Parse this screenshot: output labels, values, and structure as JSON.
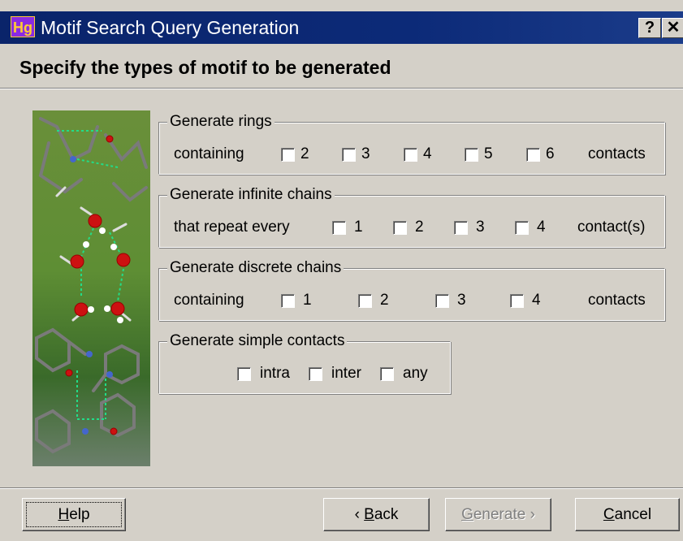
{
  "window": {
    "app_icon_text": "Hg",
    "title": "Motif Search Query Generation",
    "help_glyph": "?",
    "close_glyph": "✕"
  },
  "heading": "Specify the types of motif to be generated",
  "rings": {
    "legend": "Generate rings",
    "prefix": "containing",
    "options": [
      "2",
      "3",
      "4",
      "5",
      "6"
    ],
    "suffix": "contacts"
  },
  "infinite": {
    "legend": "Generate infinite chains",
    "prefix": "that repeat every",
    "options": [
      "1",
      "2",
      "3",
      "4"
    ],
    "suffix": "contact(s)"
  },
  "discrete": {
    "legend": "Generate discrete chains",
    "prefix": "containing",
    "options": [
      "1",
      "2",
      "3",
      "4"
    ],
    "suffix": "contacts"
  },
  "simple": {
    "legend": "Generate simple contacts",
    "options": [
      "intra",
      "inter",
      "any"
    ]
  },
  "buttons": {
    "help_mnemonic": "H",
    "help_rest": "elp",
    "back_prefix": "‹ ",
    "back_mnemonic": "B",
    "back_rest": "ack",
    "generate_mnemonic": "G",
    "generate_rest": "enerate ›",
    "cancel_mnemonic": "C",
    "cancel_rest": "ancel"
  }
}
